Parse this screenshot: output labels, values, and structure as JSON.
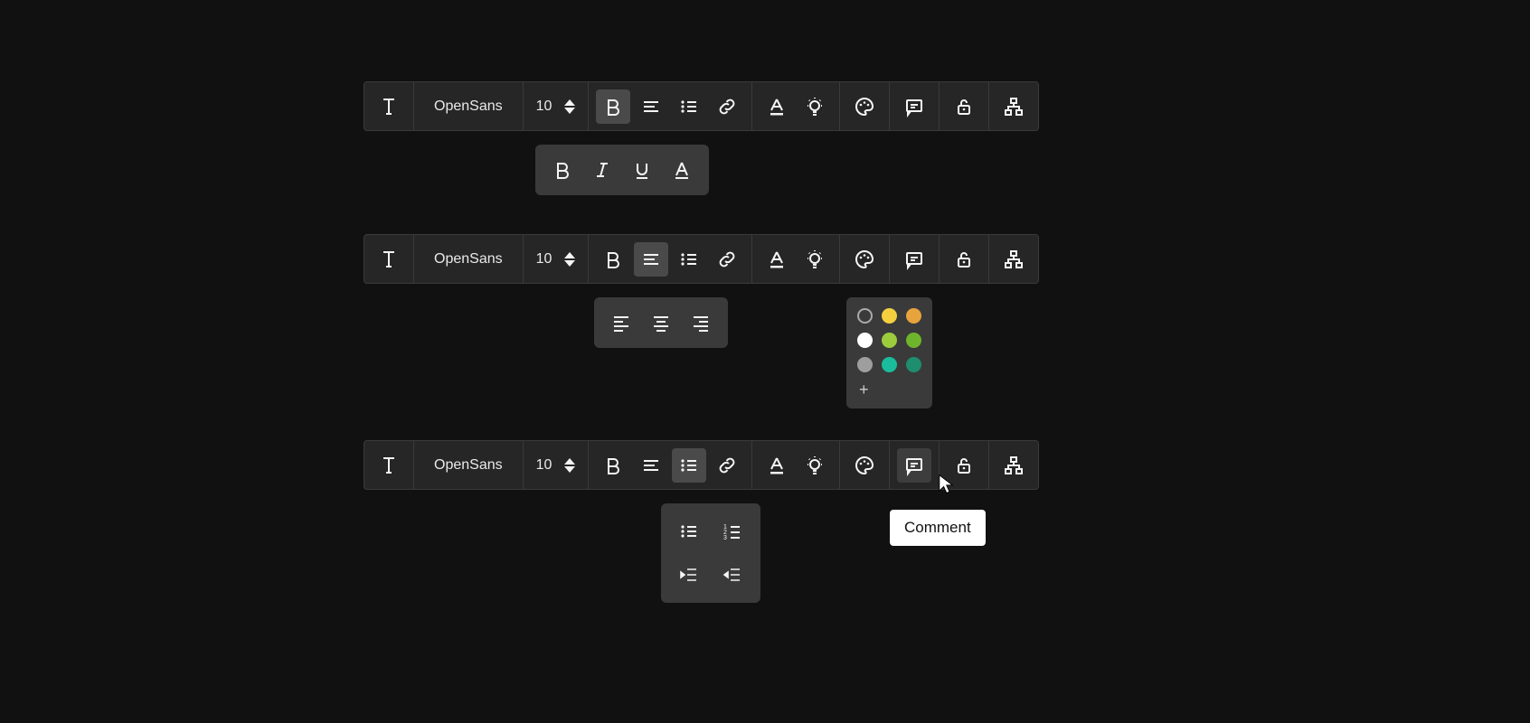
{
  "toolbars": {
    "row1": {
      "font": "OpenSans",
      "size": "10"
    },
    "row2": {
      "font": "OpenSans",
      "size": "10"
    },
    "row3": {
      "font": "OpenSans",
      "size": "10"
    }
  },
  "tooltip": {
    "comment": "Comment"
  },
  "palette": {
    "colors": [
      [
        "transparent",
        "#f4d03f",
        "#e8a33d"
      ],
      [
        "#ffffff",
        "#9ccc3c",
        "#6fb52c"
      ],
      [
        "#9e9e9e",
        "#1abc9c",
        "#1e8e6e"
      ]
    ],
    "plus": "+"
  }
}
